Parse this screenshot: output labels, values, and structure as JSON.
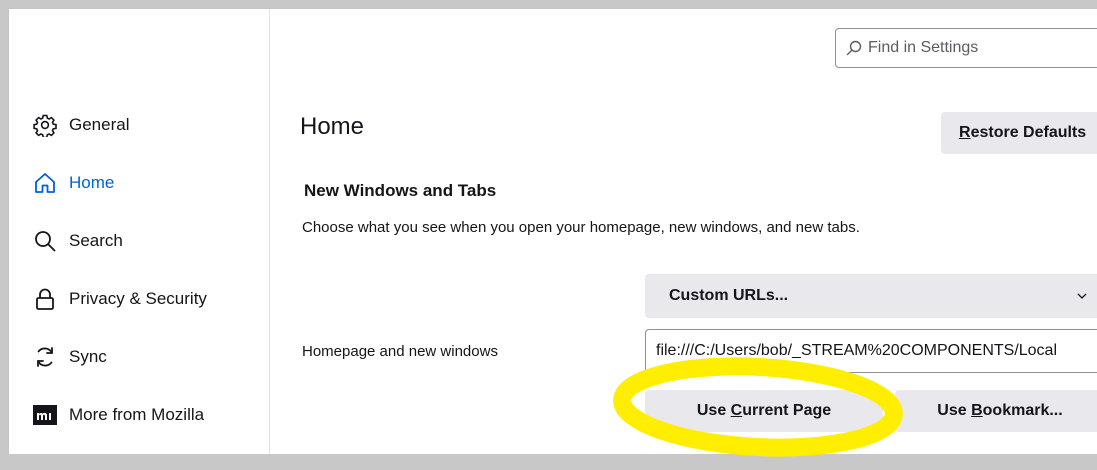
{
  "sidebar": {
    "items": [
      {
        "label": "General",
        "icon": "gear-icon",
        "active": false
      },
      {
        "label": "Home",
        "icon": "home-icon",
        "active": true
      },
      {
        "label": "Search",
        "icon": "search-icon",
        "active": false
      },
      {
        "label": "Privacy & Security",
        "icon": "lock-icon",
        "active": false
      },
      {
        "label": "Sync",
        "icon": "sync-icon",
        "active": false
      },
      {
        "label": "More from Mozilla",
        "icon": "mozilla-logo-icon",
        "active": false
      }
    ]
  },
  "search": {
    "placeholder": "Find in Settings",
    "value": ""
  },
  "page": {
    "title": "Home",
    "restore_label": "Restore Defaults",
    "restore_accesskey": "R"
  },
  "section": {
    "title": "New Windows and Tabs",
    "description": "Choose what you see when you open your homepage, new windows, and new tabs."
  },
  "homepage": {
    "select_value": "Custom URLs...",
    "field_label": "Homepage and new windows",
    "url_value": "file:///C:/Users/bob/_STREAM%20COMPONENTS/Local",
    "use_current_prefix": "Use ",
    "use_current_key": "C",
    "use_current_suffix": "urrent Page",
    "use_bookmark_prefix": "Use ",
    "use_bookmark_key": "B",
    "use_bookmark_suffix": "ookmark..."
  },
  "colors": {
    "accent": "#0061e0",
    "button_bg": "#e9e9ed",
    "highlight": "#ffee00",
    "frame_bg": "#c8c8c8"
  }
}
